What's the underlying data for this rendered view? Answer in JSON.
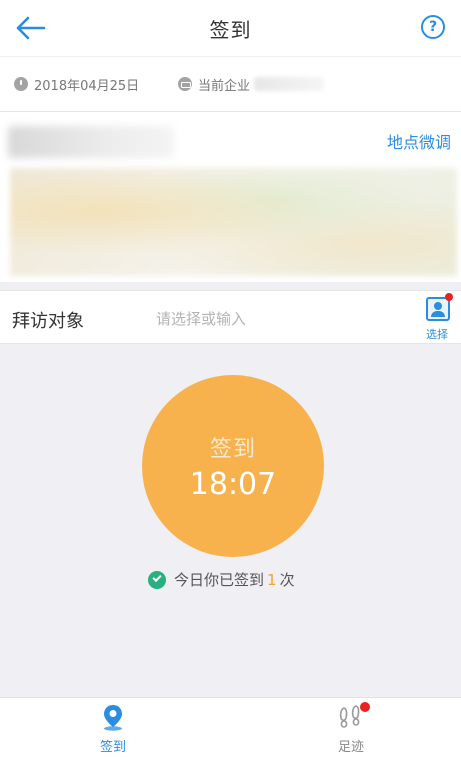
{
  "header": {
    "title": "签到",
    "help_label": "?"
  },
  "info": {
    "date": "2018年04月25日",
    "company_label": "当前企业"
  },
  "location": {
    "adjust_label": "地点微调"
  },
  "visit": {
    "label": "拜访对象",
    "placeholder": "请选择或输入",
    "select_label": "选择"
  },
  "signin": {
    "label": "签到",
    "time": "18:07",
    "count_prefix": "今日你已签到",
    "count": "1",
    "count_suffix": "次"
  },
  "nav": {
    "items": [
      {
        "label": "签到",
        "icon": "location-pin-icon",
        "active": true
      },
      {
        "label": "足迹",
        "icon": "footprint-icon",
        "active": false
      }
    ]
  },
  "colors": {
    "accent": "#2a8de0",
    "signin_circle": "#f7b24e",
    "check": "#27b17f",
    "badge": "#e8231f"
  }
}
